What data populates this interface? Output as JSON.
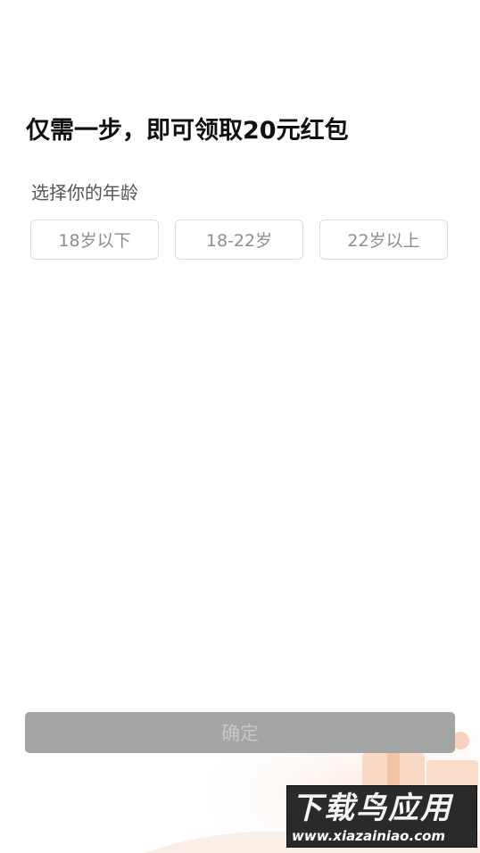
{
  "header": {
    "title": "仅需一步，即可领取20元红包"
  },
  "age": {
    "label": "选择你的年龄",
    "options": [
      "18岁以下",
      "18-22岁",
      "22岁以上"
    ]
  },
  "footer": {
    "confirm_label": "确定"
  },
  "watermark": {
    "title": "下载鸟应用",
    "url": "www.xiazainiao.com"
  },
  "colors": {
    "confirm_bg": "#a2a5a4",
    "option_border": "#dcdcdc",
    "decor_accent": "#f6c7a8"
  }
}
